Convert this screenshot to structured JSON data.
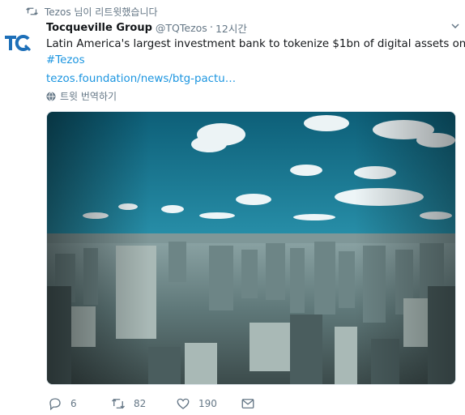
{
  "retweet_header": {
    "text": "Tezos 님이 리트윗했습니다",
    "icon": "retweet-icon"
  },
  "author": {
    "name": "Tocqueville Group",
    "handle": "@TQTezos",
    "separator": "·",
    "time": "12시간",
    "avatar_text": "TQ"
  },
  "tweet": {
    "text": "Latin America's largest investment bank to tokenize $1bn of digital assets on",
    "hashtag": "#Tezos",
    "link": "tezos.foundation/news/btg-pactu…"
  },
  "translate": {
    "label": "트윗 번역하기",
    "icon": "globe-icon"
  },
  "media": {
    "description_icon": "city-skyline-photo"
  },
  "actions": {
    "reply": {
      "icon": "reply-icon",
      "count": "6"
    },
    "retweet": {
      "icon": "retweet-icon",
      "count": "82"
    },
    "like": {
      "icon": "heart-icon",
      "count": "190"
    },
    "message": {
      "icon": "envelope-icon"
    }
  },
  "colors": {
    "accent": "#1b95e0",
    "muted": "#657786",
    "brand": "#1d6fb8"
  }
}
